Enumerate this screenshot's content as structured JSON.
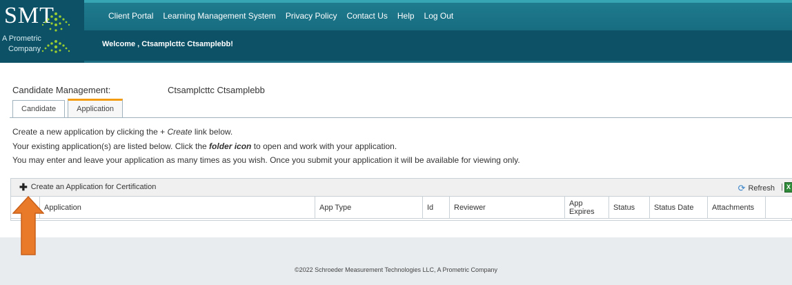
{
  "header": {
    "logo": {
      "text": "SMT",
      "sub_line1": "A Prometric",
      "sub_line2": "Company"
    },
    "nav": [
      "Client Portal",
      "Learning Management System",
      "Privacy Policy",
      "Contact Us",
      "Help",
      "Log Out"
    ],
    "welcome": "Welcome , Ctsamplcttc Ctsamplebb!"
  },
  "candidate": {
    "label": "Candidate Management:",
    "name": "Ctsamplcttc Ctsamplebb"
  },
  "tabs": [
    {
      "label": "Candidate",
      "active": false
    },
    {
      "label": "Application",
      "active": true
    }
  ],
  "instructions": {
    "line1_prefix": "Create a new application by clicking the + ",
    "line1_link": "Create",
    "line1_suffix": " link below.",
    "line2_prefix": "Your existing application(s) are listed below. Click the ",
    "line2_bold": "folder icon",
    "line2_suffix": " to open and work with your application.",
    "line3": "You may enter and leave your application as many times as you wish. Once you submit your application it will be available for viewing only."
  },
  "grid": {
    "create_label": "Create an Application for Certification",
    "refresh_label": "Refresh",
    "separator": "|",
    "excel_glyph": "X",
    "plus_glyph": "✚",
    "refresh_glyph": "⟳",
    "columns": [
      "Application",
      "App Type",
      "Id",
      "Reviewer",
      "App Expires",
      "Status",
      "Status Date",
      "Attachments"
    ]
  },
  "footer": {
    "copyright": "©2022 Schroeder Measurement Technologies LLC, A Prometric Company"
  },
  "colors": {
    "header_bg": "#0f5d72",
    "tab_active_accent": "#f39c12",
    "arrow": "#e87a2a",
    "footer_bg": "#e8ecef"
  }
}
